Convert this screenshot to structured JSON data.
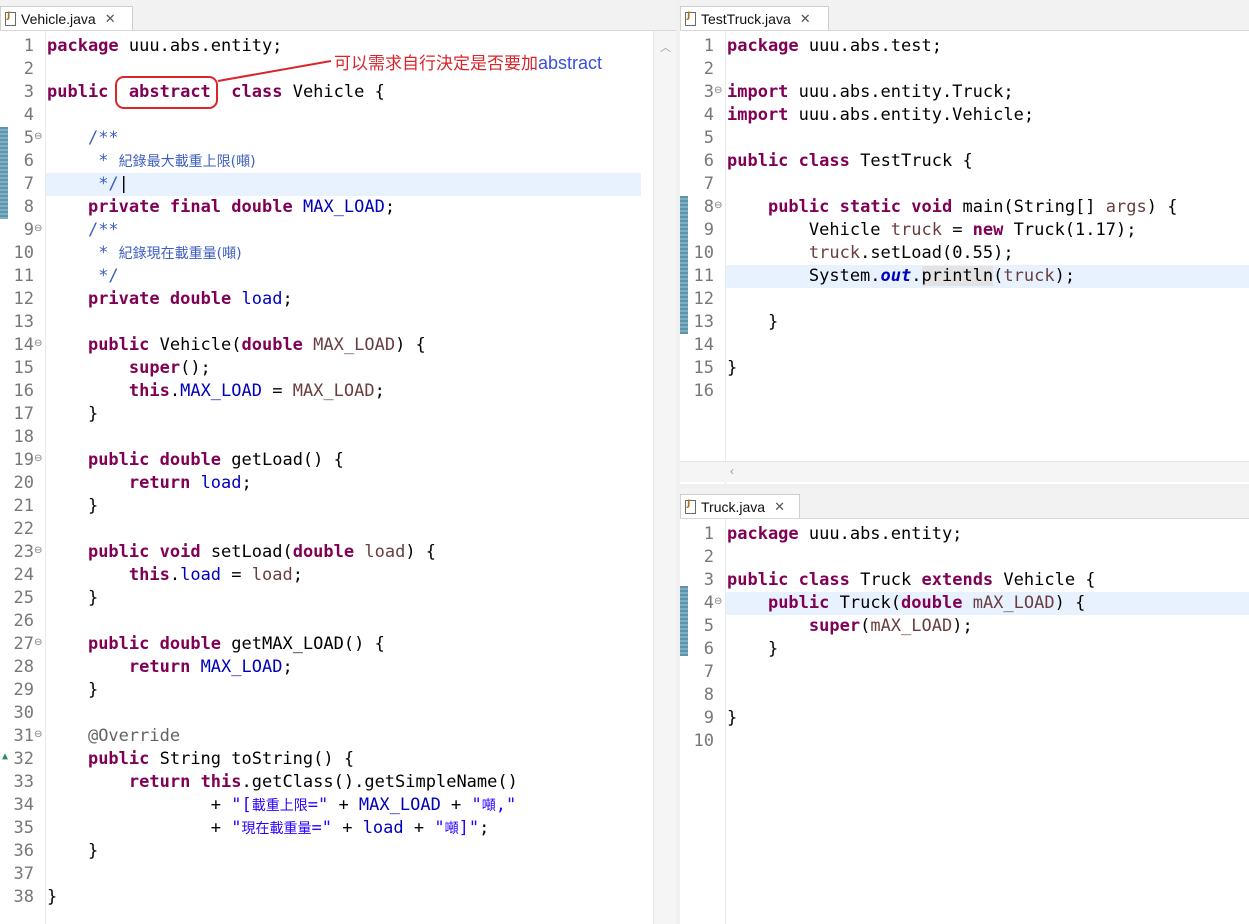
{
  "vehicle": {
    "tab": {
      "title": "Vehicle.java",
      "close": "✕"
    },
    "lines": [
      {
        "n": "1",
        "html": "<span class=\"kw\">package</span> uuu.abs.entity;"
      },
      {
        "n": "2",
        "html": ""
      },
      {
        "n": "3",
        "html": "<span class=\"kw\">public</span>  <span class=\"kw\">abstract</span>  <span class=\"kw\">class</span> Vehicle {"
      },
      {
        "n": "4",
        "html": ""
      },
      {
        "n": "5",
        "fold": true,
        "html": "    <span class=\"cmt\">/**</span>"
      },
      {
        "n": "6",
        "html": "     <span class=\"cmt\">* <span class=\"cjk\">紀錄最大載重上限(噸)</span></span>"
      },
      {
        "n": "7",
        "hl": true,
        "html": "     <span class=\"cmt\">*/</span>|"
      },
      {
        "n": "8",
        "html": "    <span class=\"kw\">private</span> <span class=\"kw\">final</span> <span class=\"kw\">double</span> <span class=\"fld\">MAX_LOAD</span>;"
      },
      {
        "n": "9",
        "fold": true,
        "html": "    <span class=\"cmt\">/**</span>"
      },
      {
        "n": "10",
        "html": "     <span class=\"cmt\">* <span class=\"cjk\">紀錄現在載重量(噸)</span></span>"
      },
      {
        "n": "11",
        "html": "     <span class=\"cmt\">*/</span>"
      },
      {
        "n": "12",
        "html": "    <span class=\"kw\">private</span> <span class=\"kw\">double</span> <span class=\"fld\">load</span>;"
      },
      {
        "n": "13",
        "html": ""
      },
      {
        "n": "14",
        "fold": true,
        "html": "    <span class=\"kw\">public</span> Vehicle(<span class=\"kw\">double</span> <span class=\"param\">MAX_LOAD</span>) {"
      },
      {
        "n": "15",
        "html": "        <span class=\"kw\">super</span>();"
      },
      {
        "n": "16",
        "html": "        <span class=\"kw\">this</span>.<span class=\"fld\">MAX_LOAD</span> = <span class=\"param\">MAX_LOAD</span>;"
      },
      {
        "n": "17",
        "html": "    }"
      },
      {
        "n": "18",
        "html": ""
      },
      {
        "n": "19",
        "fold": true,
        "html": "    <span class=\"kw\">public</span> <span class=\"kw\">double</span> getLoad() {"
      },
      {
        "n": "20",
        "html": "        <span class=\"kw\">return</span> <span class=\"fld\">load</span>;"
      },
      {
        "n": "21",
        "html": "    }"
      },
      {
        "n": "22",
        "html": ""
      },
      {
        "n": "23",
        "fold": true,
        "html": "    <span class=\"kw\">public</span> <span class=\"kw\">void</span> setLoad(<span class=\"kw\">double</span> <span class=\"param\">load</span>) {"
      },
      {
        "n": "24",
        "html": "        <span class=\"kw\">this</span>.<span class=\"fld\">load</span> = <span class=\"param\">load</span>;"
      },
      {
        "n": "25",
        "html": "    }"
      },
      {
        "n": "26",
        "html": ""
      },
      {
        "n": "27",
        "fold": true,
        "html": "    <span class=\"kw\">public</span> <span class=\"kw\">double</span> getMAX_LOAD() {"
      },
      {
        "n": "28",
        "html": "        <span class=\"kw\">return</span> <span class=\"fld\">MAX_LOAD</span>;"
      },
      {
        "n": "29",
        "html": "    }"
      },
      {
        "n": "30",
        "html": ""
      },
      {
        "n": "31",
        "fold": true,
        "html": "    <span class=\"ann\">@Override</span>"
      },
      {
        "n": "32",
        "override": true,
        "html": "    <span class=\"kw\">public</span> String toString() {"
      },
      {
        "n": "33",
        "html": "        <span class=\"kw\">return</span> <span class=\"kw\">this</span>.getClass().getSimpleName()"
      },
      {
        "n": "34",
        "html": "                + <span class=\"str\">\"[<span class=\"cjk\">載重上限</span>=\"</span> + <span class=\"fld\">MAX_LOAD</span> + <span class=\"str\">\"<span class=\"cjk\">噸</span>,\"</span>"
      },
      {
        "n": "35",
        "html": "                + <span class=\"str\">\"<span class=\"cjk\">現在載重量</span>=\"</span> + <span class=\"fld\">load</span> + <span class=\"str\">\"<span class=\"cjk\">噸</span>]\"</span>;"
      },
      {
        "n": "36",
        "html": "    }"
      },
      {
        "n": "37",
        "html": ""
      },
      {
        "n": "38",
        "html": "}"
      }
    ],
    "callout": {
      "cn": "可以需求自行決定是否要加",
      "en": "abstract"
    }
  },
  "testtruck": {
    "tab": {
      "title": "TestTruck.java",
      "close": "✕"
    },
    "lines": [
      {
        "n": "1",
        "html": "<span class=\"kw\">package</span> uuu.abs.test;"
      },
      {
        "n": "2",
        "html": ""
      },
      {
        "n": "3",
        "fold": true,
        "html": "<span class=\"kw\">import</span> uuu.abs.entity.Truck;"
      },
      {
        "n": "4",
        "html": "<span class=\"kw\">import</span> uuu.abs.entity.Vehicle;"
      },
      {
        "n": "5",
        "html": ""
      },
      {
        "n": "6",
        "html": "<span class=\"kw\">public</span> <span class=\"kw\">class</span> TestTruck {"
      },
      {
        "n": "7",
        "html": ""
      },
      {
        "n": "8",
        "fold": true,
        "html": "    <span class=\"kw\">public</span> <span class=\"kw\">static</span> <span class=\"kw\">void</span> main(String[] <span class=\"param\">args</span>) {"
      },
      {
        "n": "9",
        "html": "        Vehicle <span class=\"param\">truck</span> = <span class=\"kw\">new</span> Truck(1.17);"
      },
      {
        "n": "10",
        "html": "        <span class=\"param\">truck</span>.setLoad(0.55);"
      },
      {
        "n": "11",
        "hl": true,
        "html": "        System.<span class=\"sfld\">out</span>.<span class=\"occ\">println</span>(<span class=\"param\">truck</span>);"
      },
      {
        "n": "12",
        "html": ""
      },
      {
        "n": "13",
        "html": "    }"
      },
      {
        "n": "14",
        "html": ""
      },
      {
        "n": "15",
        "html": "}"
      },
      {
        "n": "16",
        "html": ""
      }
    ]
  },
  "truck": {
    "tab": {
      "title": "Truck.java",
      "close": "✕"
    },
    "lines": [
      {
        "n": "1",
        "html": "<span class=\"kw\">package</span> uuu.abs.entity;"
      },
      {
        "n": "2",
        "html": ""
      },
      {
        "n": "3",
        "html": "<span class=\"kw\">public</span> <span class=\"kw\">class</span> Truck <span class=\"kw\">extends</span> Vehicle {"
      },
      {
        "n": "4",
        "fold": true,
        "hl": true,
        "html": "    <span class=\"kw\">public</span> Truck(<span class=\"kw\">double</span> <span class=\"param\">mAX_LOAD</span>) {"
      },
      {
        "n": "5",
        "html": "        <span class=\"kw\">super</span>(<span class=\"param\">mAX_LOAD</span>);"
      },
      {
        "n": "6",
        "html": "    }"
      },
      {
        "n": "7",
        "html": ""
      },
      {
        "n": "8",
        "html": ""
      },
      {
        "n": "9",
        "html": "}"
      },
      {
        "n": "10",
        "html": ""
      }
    ]
  }
}
